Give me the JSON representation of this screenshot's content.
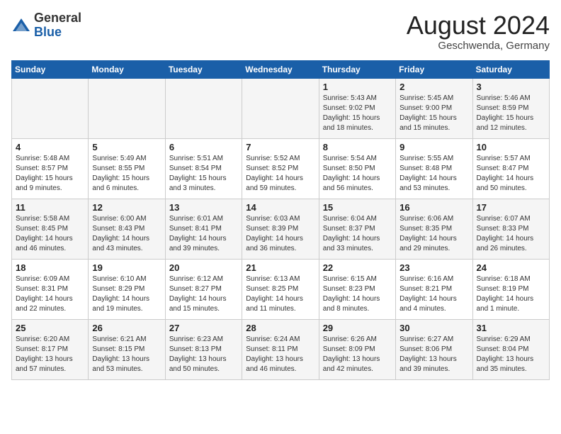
{
  "header": {
    "logo_general": "General",
    "logo_blue": "Blue",
    "month_title": "August 2024",
    "location": "Geschwenda, Germany"
  },
  "weekdays": [
    "Sunday",
    "Monday",
    "Tuesday",
    "Wednesday",
    "Thursday",
    "Friday",
    "Saturday"
  ],
  "weeks": [
    [
      {
        "day": "",
        "info": ""
      },
      {
        "day": "",
        "info": ""
      },
      {
        "day": "",
        "info": ""
      },
      {
        "day": "",
        "info": ""
      },
      {
        "day": "1",
        "info": "Sunrise: 5:43 AM\nSunset: 9:02 PM\nDaylight: 15 hours\nand 18 minutes."
      },
      {
        "day": "2",
        "info": "Sunrise: 5:45 AM\nSunset: 9:00 PM\nDaylight: 15 hours\nand 15 minutes."
      },
      {
        "day": "3",
        "info": "Sunrise: 5:46 AM\nSunset: 8:59 PM\nDaylight: 15 hours\nand 12 minutes."
      }
    ],
    [
      {
        "day": "4",
        "info": "Sunrise: 5:48 AM\nSunset: 8:57 PM\nDaylight: 15 hours\nand 9 minutes."
      },
      {
        "day": "5",
        "info": "Sunrise: 5:49 AM\nSunset: 8:55 PM\nDaylight: 15 hours\nand 6 minutes."
      },
      {
        "day": "6",
        "info": "Sunrise: 5:51 AM\nSunset: 8:54 PM\nDaylight: 15 hours\nand 3 minutes."
      },
      {
        "day": "7",
        "info": "Sunrise: 5:52 AM\nSunset: 8:52 PM\nDaylight: 14 hours\nand 59 minutes."
      },
      {
        "day": "8",
        "info": "Sunrise: 5:54 AM\nSunset: 8:50 PM\nDaylight: 14 hours\nand 56 minutes."
      },
      {
        "day": "9",
        "info": "Sunrise: 5:55 AM\nSunset: 8:48 PM\nDaylight: 14 hours\nand 53 minutes."
      },
      {
        "day": "10",
        "info": "Sunrise: 5:57 AM\nSunset: 8:47 PM\nDaylight: 14 hours\nand 50 minutes."
      }
    ],
    [
      {
        "day": "11",
        "info": "Sunrise: 5:58 AM\nSunset: 8:45 PM\nDaylight: 14 hours\nand 46 minutes."
      },
      {
        "day": "12",
        "info": "Sunrise: 6:00 AM\nSunset: 8:43 PM\nDaylight: 14 hours\nand 43 minutes."
      },
      {
        "day": "13",
        "info": "Sunrise: 6:01 AM\nSunset: 8:41 PM\nDaylight: 14 hours\nand 39 minutes."
      },
      {
        "day": "14",
        "info": "Sunrise: 6:03 AM\nSunset: 8:39 PM\nDaylight: 14 hours\nand 36 minutes."
      },
      {
        "day": "15",
        "info": "Sunrise: 6:04 AM\nSunset: 8:37 PM\nDaylight: 14 hours\nand 33 minutes."
      },
      {
        "day": "16",
        "info": "Sunrise: 6:06 AM\nSunset: 8:35 PM\nDaylight: 14 hours\nand 29 minutes."
      },
      {
        "day": "17",
        "info": "Sunrise: 6:07 AM\nSunset: 8:33 PM\nDaylight: 14 hours\nand 26 minutes."
      }
    ],
    [
      {
        "day": "18",
        "info": "Sunrise: 6:09 AM\nSunset: 8:31 PM\nDaylight: 14 hours\nand 22 minutes."
      },
      {
        "day": "19",
        "info": "Sunrise: 6:10 AM\nSunset: 8:29 PM\nDaylight: 14 hours\nand 19 minutes."
      },
      {
        "day": "20",
        "info": "Sunrise: 6:12 AM\nSunset: 8:27 PM\nDaylight: 14 hours\nand 15 minutes."
      },
      {
        "day": "21",
        "info": "Sunrise: 6:13 AM\nSunset: 8:25 PM\nDaylight: 14 hours\nand 11 minutes."
      },
      {
        "day": "22",
        "info": "Sunrise: 6:15 AM\nSunset: 8:23 PM\nDaylight: 14 hours\nand 8 minutes."
      },
      {
        "day": "23",
        "info": "Sunrise: 6:16 AM\nSunset: 8:21 PM\nDaylight: 14 hours\nand 4 minutes."
      },
      {
        "day": "24",
        "info": "Sunrise: 6:18 AM\nSunset: 8:19 PM\nDaylight: 14 hours\nand 1 minute."
      }
    ],
    [
      {
        "day": "25",
        "info": "Sunrise: 6:20 AM\nSunset: 8:17 PM\nDaylight: 13 hours\nand 57 minutes."
      },
      {
        "day": "26",
        "info": "Sunrise: 6:21 AM\nSunset: 8:15 PM\nDaylight: 13 hours\nand 53 minutes."
      },
      {
        "day": "27",
        "info": "Sunrise: 6:23 AM\nSunset: 8:13 PM\nDaylight: 13 hours\nand 50 minutes."
      },
      {
        "day": "28",
        "info": "Sunrise: 6:24 AM\nSunset: 8:11 PM\nDaylight: 13 hours\nand 46 minutes."
      },
      {
        "day": "29",
        "info": "Sunrise: 6:26 AM\nSunset: 8:09 PM\nDaylight: 13 hours\nand 42 minutes."
      },
      {
        "day": "30",
        "info": "Sunrise: 6:27 AM\nSunset: 8:06 PM\nDaylight: 13 hours\nand 39 minutes."
      },
      {
        "day": "31",
        "info": "Sunrise: 6:29 AM\nSunset: 8:04 PM\nDaylight: 13 hours\nand 35 minutes."
      }
    ]
  ]
}
